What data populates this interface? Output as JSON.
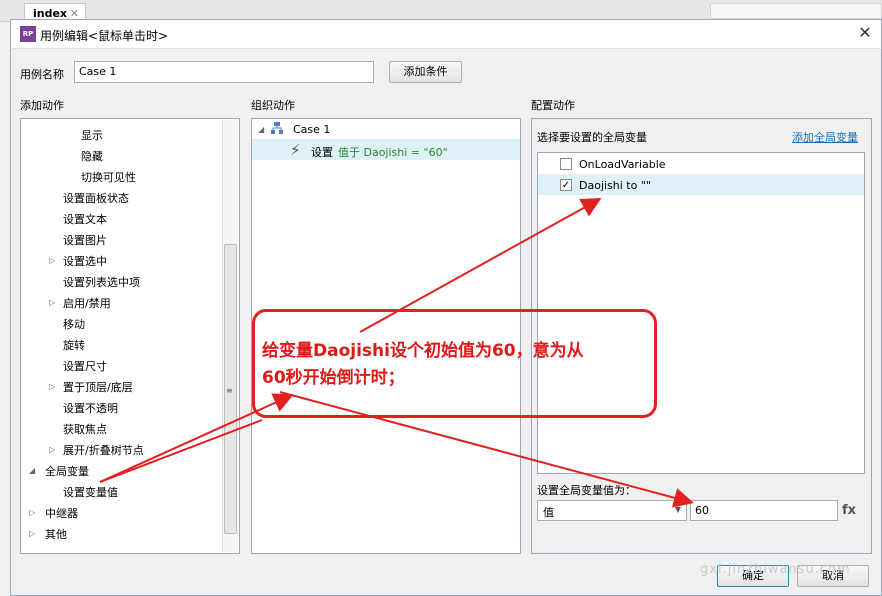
{
  "background": {
    "tab_label": "index",
    "tab_close": "✕"
  },
  "dialog": {
    "title": "用例编辑<鼠标单击时>",
    "app_icon": "RP",
    "close": "✕",
    "case_name_label": "用例名称",
    "case_name_value": "Case 1",
    "add_condition": "添加条件",
    "ok": "确定",
    "cancel": "取消"
  },
  "left": {
    "header": "添加动作",
    "items": [
      {
        "label": "显示"
      },
      {
        "label": "隐藏"
      },
      {
        "label": "切换可见性"
      },
      {
        "label": "设置面板状态"
      },
      {
        "label": "设置文本"
      },
      {
        "label": "设置图片"
      },
      {
        "label": "设置选中"
      },
      {
        "label": "设置列表选中项"
      },
      {
        "label": "启用/禁用"
      },
      {
        "label": "移动"
      },
      {
        "label": "旋转"
      },
      {
        "label": "设置尺寸"
      },
      {
        "label": "置于顶层/底层"
      },
      {
        "label": "设置不透明"
      },
      {
        "label": "获取焦点"
      },
      {
        "label": "展开/折叠树节点"
      },
      {
        "label": "全局变量"
      },
      {
        "label": "设置变量值"
      },
      {
        "label": "中继器"
      },
      {
        "label": "其他"
      }
    ]
  },
  "middle": {
    "header": "组织动作",
    "case": "Case 1",
    "action_prefix": "设置",
    "action_detail": "值于 Daojishi = \"60\""
  },
  "right": {
    "header": "配置动作",
    "select_label": "选择要设置的全局变量",
    "add_link": "添加全局变量",
    "variables": [
      {
        "name": "OnLoadVariable",
        "checked": false
      },
      {
        "name": "Daojishi to \"\"",
        "checked": true
      }
    ],
    "set_label": "设置全局变量值为：",
    "value_type": "值",
    "value": "60",
    "fx": "fx"
  },
  "annotation": {
    "line1": "给变量Daojishi设个初始值为60，意为从",
    "line2": "60秒开始倒计时；"
  },
  "watermark": "gxl.jinzhiwansu.com",
  "colors": {
    "annotation": "#e32020",
    "selection": "#dff1f8",
    "link": "#1a6fb5"
  }
}
